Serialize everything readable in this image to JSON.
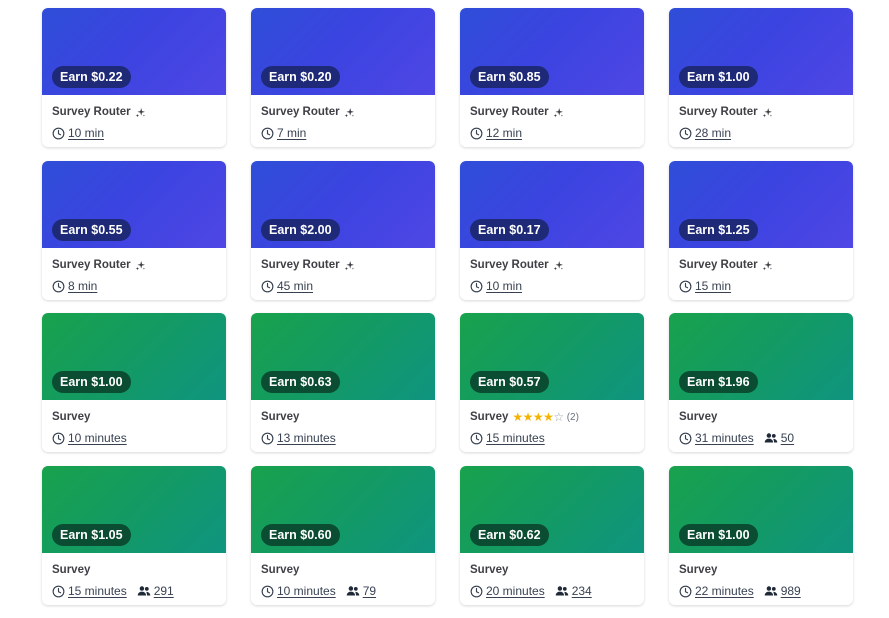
{
  "cards": [
    {
      "earn": "Earn $0.22",
      "title": "Survey Router",
      "time": "10 min",
      "theme": "blue"
    },
    {
      "earn": "Earn $0.20",
      "title": "Survey Router",
      "time": "7 min",
      "theme": "blue"
    },
    {
      "earn": "Earn $0.85",
      "title": "Survey Router",
      "time": "12 min",
      "theme": "blue"
    },
    {
      "earn": "Earn $1.00",
      "title": "Survey Router",
      "time": "28 min",
      "theme": "blue"
    },
    {
      "earn": "Earn $0.55",
      "title": "Survey Router",
      "time": "8 min",
      "theme": "blue"
    },
    {
      "earn": "Earn $2.00",
      "title": "Survey Router",
      "time": "45 min",
      "theme": "blue"
    },
    {
      "earn": "Earn $0.17",
      "title": "Survey Router",
      "time": "10 min",
      "theme": "blue"
    },
    {
      "earn": "Earn $1.25",
      "title": "Survey Router",
      "time": "15 min",
      "theme": "blue"
    },
    {
      "earn": "Earn $1.00",
      "title": "Survey",
      "time": "10 minutes",
      "theme": "green"
    },
    {
      "earn": "Earn $0.63",
      "title": "Survey",
      "time": "13 minutes",
      "theme": "green"
    },
    {
      "earn": "Earn $0.57",
      "title": "Survey",
      "time": "15 minutes",
      "theme": "green",
      "rating": 4,
      "rating_count": "(2)"
    },
    {
      "earn": "Earn $1.96",
      "title": "Survey",
      "time": "31 minutes",
      "theme": "green",
      "participants": "50"
    },
    {
      "earn": "Earn $1.05",
      "title": "Survey",
      "time": "15 minutes",
      "theme": "green",
      "participants": "291"
    },
    {
      "earn": "Earn $0.60",
      "title": "Survey",
      "time": "10 minutes",
      "theme": "green",
      "participants": "79"
    },
    {
      "earn": "Earn $0.62",
      "title": "Survey",
      "time": "20 minutes",
      "theme": "green",
      "participants": "234"
    },
    {
      "earn": "Earn $1.00",
      "title": "Survey",
      "time": "22 minutes",
      "theme": "green",
      "participants": "989"
    }
  ],
  "icons": {
    "router_badge": "sparkle-icon",
    "duration": "clock-icon",
    "participants": "users-icon",
    "rating": "star-icon"
  },
  "colors": {
    "router_gradient": [
      "#2f4ed8",
      "#4f46e5"
    ],
    "survey_gradient": [
      "#18a24c",
      "#0f9480"
    ],
    "star": "#f5b301"
  }
}
